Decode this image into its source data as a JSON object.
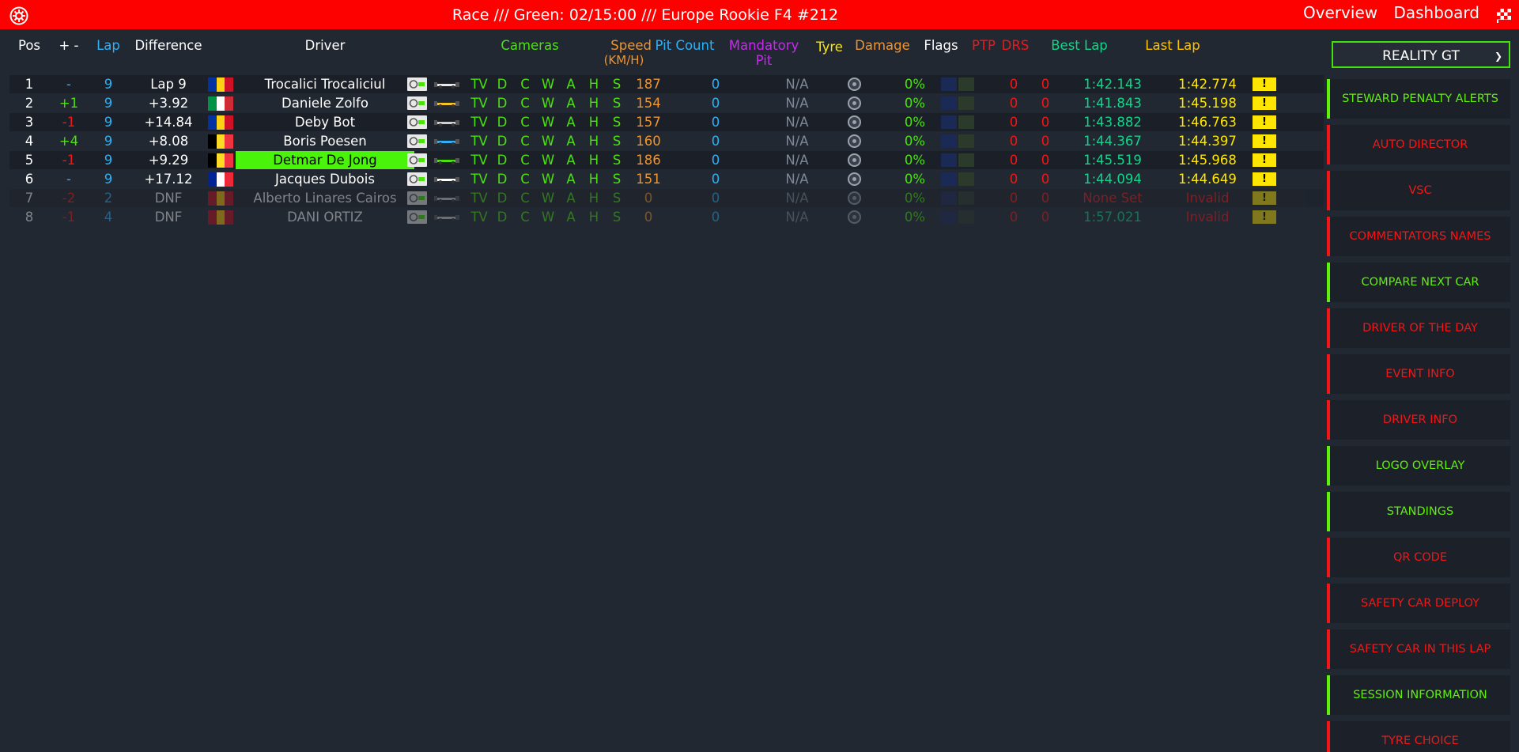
{
  "header": {
    "title": "Race /// Green: 02/15:00 /// Europe Rookie F4 #212",
    "nav": [
      "Overview",
      "Dashboard"
    ]
  },
  "colors": {
    "topbar": "#fd0000",
    "green": "#4ae20d",
    "orange": "#f0942c",
    "blue": "#2fb0f5",
    "magenta": "#c42ce8",
    "yellow": "#ffe600",
    "red": "#f41616",
    "teal": "#12d48a"
  },
  "columns": {
    "pos": "Pos",
    "diff_change": "+ -",
    "lap": "Lap",
    "difference": "Difference",
    "driver": "Driver",
    "cameras": "Cameras",
    "speed": "Speed",
    "speed_unit": "(KM/H)",
    "pit_count": "Pit Count",
    "mandatory": "Mandatory",
    "pit": "Pit",
    "tyre": "Tyre",
    "damage": "Damage",
    "flags": "Flags",
    "ptp": "PTP",
    "drs": "DRS",
    "best_lap": "Best Lap",
    "last_lap": "Last Lap"
  },
  "cameras": [
    "TV",
    "D",
    "C",
    "W",
    "A",
    "H",
    "S"
  ],
  "rows": [
    {
      "pos": "1",
      "change": "-",
      "lap": "9",
      "difference": "Lap 9",
      "flag": [
        "#0033a0",
        "#fcd116",
        "#ce1126"
      ],
      "driver": "Trocalici Trocaliciul",
      "speed": "187",
      "pit": "0",
      "mandatory": "N/A",
      "damage": "0%",
      "ptp": "0",
      "drs": "0",
      "best": "1:42.143",
      "last": "1:42.774",
      "alert": "!",
      "highlight": false,
      "dnf": false,
      "change_color": "#2fb0f5",
      "car": "#e8e8e8"
    },
    {
      "pos": "2",
      "change": "+1",
      "lap": "9",
      "difference": "+3.92",
      "flag": [
        "#009246",
        "#ffffff",
        "#ce2b37"
      ],
      "driver": "Daniele Zolfo",
      "speed": "154",
      "pit": "0",
      "mandatory": "N/A",
      "damage": "0%",
      "ptp": "0",
      "drs": "0",
      "best": "1:41.843",
      "last": "1:45.198",
      "alert": "!",
      "highlight": false,
      "dnf": false,
      "change_color": "#4ae20d",
      "car": "#f6c22c"
    },
    {
      "pos": "3",
      "change": "-1",
      "lap": "9",
      "difference": "+14.84",
      "flag": [
        "#0033a0",
        "#fcd116",
        "#ce1126"
      ],
      "driver": "Deby Bot",
      "speed": "157",
      "pit": "0",
      "mandatory": "N/A",
      "damage": "0%",
      "ptp": "0",
      "drs": "0",
      "best": "1:43.882",
      "last": "1:46.763",
      "alert": "!",
      "highlight": false,
      "dnf": false,
      "change_color": "#f41616",
      "car": "#d0d0d0"
    },
    {
      "pos": "4",
      "change": "+4",
      "lap": "9",
      "difference": "+8.08",
      "flag": [
        "#000000",
        "#fdda24",
        "#ef3340"
      ],
      "driver": "Boris Poesen",
      "speed": "160",
      "pit": "0",
      "mandatory": "N/A",
      "damage": "0%",
      "ptp": "0",
      "drs": "0",
      "best": "1:44.367",
      "last": "1:44.397",
      "alert": "!",
      "highlight": false,
      "dnf": false,
      "change_color": "#4ae20d",
      "car": "#2fb0f5"
    },
    {
      "pos": "5",
      "change": "-1",
      "lap": "9",
      "difference": "+9.29",
      "flag": [
        "#000000",
        "#fdda24",
        "#ef3340"
      ],
      "driver": "Detmar De Jong",
      "speed": "186",
      "pit": "0",
      "mandatory": "N/A",
      "damage": "0%",
      "ptp": "0",
      "drs": "0",
      "best": "1:45.519",
      "last": "1:45.968",
      "alert": "!",
      "highlight": true,
      "dnf": false,
      "change_color": "#f41616",
      "car": "#4ae20d"
    },
    {
      "pos": "6",
      "change": "-",
      "lap": "9",
      "difference": "+17.12",
      "flag": [
        "#002395",
        "#ffffff",
        "#ed2939"
      ],
      "driver": "Jacques Dubois",
      "speed": "151",
      "pit": "0",
      "mandatory": "N/A",
      "damage": "0%",
      "ptp": "0",
      "drs": "0",
      "best": "1:44.094",
      "last": "1:44.649",
      "alert": "!",
      "highlight": false,
      "dnf": false,
      "change_color": "#2fb0f5",
      "car": "#ffffff"
    },
    {
      "pos": "7",
      "change": "-2",
      "lap": "2",
      "difference": "DNF",
      "flag": [
        "#c60b1e",
        "#ffc400",
        "#c60b1e"
      ],
      "driver": "Alberto Linares Cairos",
      "speed": "0",
      "pit": "0",
      "mandatory": "N/A",
      "damage": "0%",
      "ptp": "0",
      "drs": "0",
      "best": "None Set",
      "last": "Invalid",
      "alert": "!",
      "highlight": false,
      "dnf": true,
      "change_color": "#f41616",
      "car": "#d0d0d0"
    },
    {
      "pos": "8",
      "change": "-1",
      "lap": "4",
      "difference": "DNF",
      "flag": [
        "#c60b1e",
        "#ffc400",
        "#c60b1e"
      ],
      "driver": "DANI ORTIZ",
      "speed": "0",
      "pit": "0",
      "mandatory": "N/A",
      "damage": "0%",
      "ptp": "0",
      "drs": "0",
      "best": "1:57.021",
      "last": "Invalid",
      "alert": "!",
      "highlight": false,
      "dnf": true,
      "change_color": "#f41616",
      "car": "#d0d0d0"
    }
  ],
  "sidebar": {
    "session_select": "REALITY GT",
    "buttons": [
      {
        "label": "STEWARD PENALTY ALERTS",
        "state": "green"
      },
      {
        "label": "AUTO DIRECTOR",
        "state": "red"
      },
      {
        "label": "VSC",
        "state": "red"
      },
      {
        "label": "COMMENTATORS NAMES",
        "state": "red"
      },
      {
        "label": "COMPARE NEXT CAR",
        "state": "green"
      },
      {
        "label": "DRIVER OF THE DAY",
        "state": "red"
      },
      {
        "label": "EVENT INFO",
        "state": "red"
      },
      {
        "label": "DRIVER INFO",
        "state": "red"
      },
      {
        "label": "LOGO OVERLAY",
        "state": "green"
      },
      {
        "label": "STANDINGS",
        "state": "green"
      },
      {
        "label": "QR CODE",
        "state": "red"
      },
      {
        "label": "SAFETY CAR DEPLOY",
        "state": "red"
      },
      {
        "label": "SAFETY CAR IN THIS LAP",
        "state": "red"
      },
      {
        "label": "SESSION INFORMATION",
        "state": "green"
      },
      {
        "label": "TYRE CHOICE",
        "state": "red"
      }
    ]
  }
}
